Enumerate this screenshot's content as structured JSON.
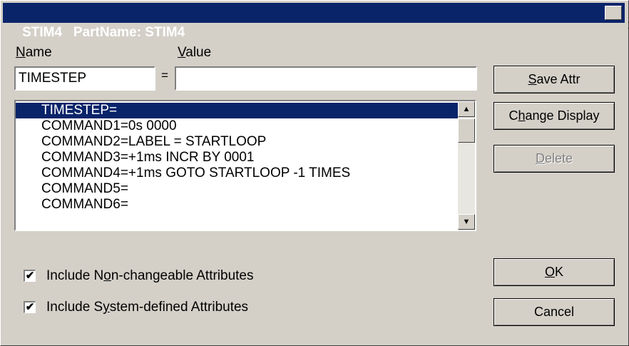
{
  "window": {
    "title": "STIM4   PartName: STIM4",
    "close_glyph": "✕"
  },
  "labels": {
    "name_prefix": "N",
    "name_rest": "ame",
    "value_prefix": "V",
    "value_rest": "alue",
    "equals": "="
  },
  "name_field": {
    "value": "TIMESTEP"
  },
  "value_field": {
    "value": ""
  },
  "attributes": [
    "TIMESTEP=",
    "COMMAND1=0s 0000",
    "COMMAND2=LABEL = STARTLOOP",
    "COMMAND3=+1ms INCR BY 0001",
    "COMMAND4=+1ms GOTO STARTLOOP -1 TIMES",
    "COMMAND5=",
    "COMMAND6="
  ],
  "buttons": {
    "save_attr": {
      "mn": "S",
      "rest": "ave Attr"
    },
    "change_display": {
      "pre": "C",
      "mn": "h",
      "rest": "ange Display"
    },
    "delete": {
      "mn": "D",
      "rest": "elete"
    },
    "ok": {
      "mn": "O",
      "rest": "K"
    },
    "cancel": "Cancel"
  },
  "checkboxes": {
    "non_changeable": {
      "pre": "Include N",
      "mn": "o",
      "rest": "n-changeable Attributes",
      "checked": true,
      "mark": "✔"
    },
    "system_defined": {
      "pre": "Include S",
      "mn": "y",
      "rest": "stem-defined Attributes",
      "checked": true,
      "mark": "✔"
    }
  },
  "scrollbar": {
    "up_glyph": "▲",
    "down_glyph": "▼"
  },
  "colors": {
    "titlebar": "#0a246a",
    "face": "#d4d0c8",
    "selection": "#0a246a"
  }
}
